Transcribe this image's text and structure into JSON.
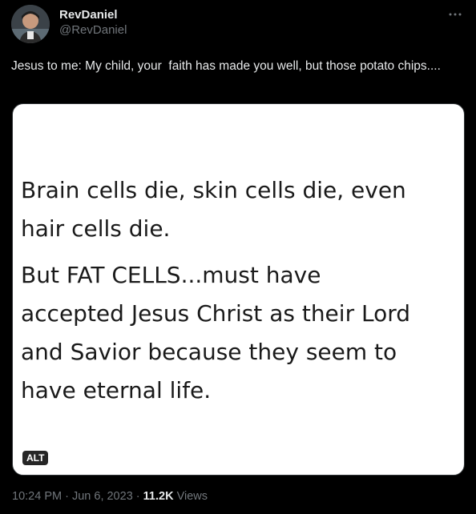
{
  "author": {
    "display_name": "RevDaniel",
    "handle": "@RevDaniel"
  },
  "menu": {
    "icon": "more-horizontal-icon"
  },
  "tweet": {
    "text": "Jesus to me: My child, your  faith has made you well, but those potato chips...."
  },
  "media": {
    "paragraph1": [
      "Brain cells die, skin cells die, even",
      "hair cells die."
    ],
    "paragraph2": [
      "But FAT CELLS...must have",
      "accepted Jesus Christ as their Lord",
      "and Savior because they seem to",
      "have eternal life."
    ],
    "alt_label": "ALT"
  },
  "meta": {
    "time": "10:24 PM",
    "sep1": " · ",
    "date": "Jun 6, 2023",
    "sep2": " · ",
    "views_count": "11.2K",
    "views_label": " Views"
  },
  "colors": {
    "background": "#000000",
    "text_primary": "#e7e9ea",
    "text_secondary": "#71767b",
    "card_bg": "#ffffff"
  }
}
